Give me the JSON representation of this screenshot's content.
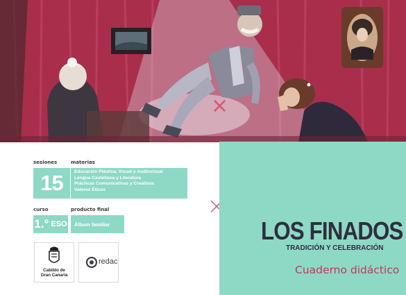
{
  "cover": {
    "sessions": {
      "label": "sesiones",
      "value": "15"
    },
    "subjects": {
      "label": "materias",
      "items": [
        "Educación Plástica, Visual y Audiovisual",
        "Lengua Castellana y Literatura",
        "Prácticas Comunicativas y Creativas",
        "Valores Éticos"
      ]
    },
    "course": {
      "label": "curso",
      "value": "1.°",
      "suffix": "ESO"
    },
    "final_product": {
      "label": "producto final",
      "value": "Álbum familiar"
    },
    "logos": {
      "cabildo_line1": "Cabildo de",
      "cabildo_line2": "Gran Canaria",
      "redac": "redac"
    },
    "title": "LOS FINADOS",
    "subtitle": "TRADICIÓN Y CELEBRACIÓN",
    "booklet": "Cuaderno didáctico"
  },
  "colors": {
    "teal": "#8ed8c6",
    "accent_red": "#c03a5d",
    "wall": "#b0304e"
  }
}
